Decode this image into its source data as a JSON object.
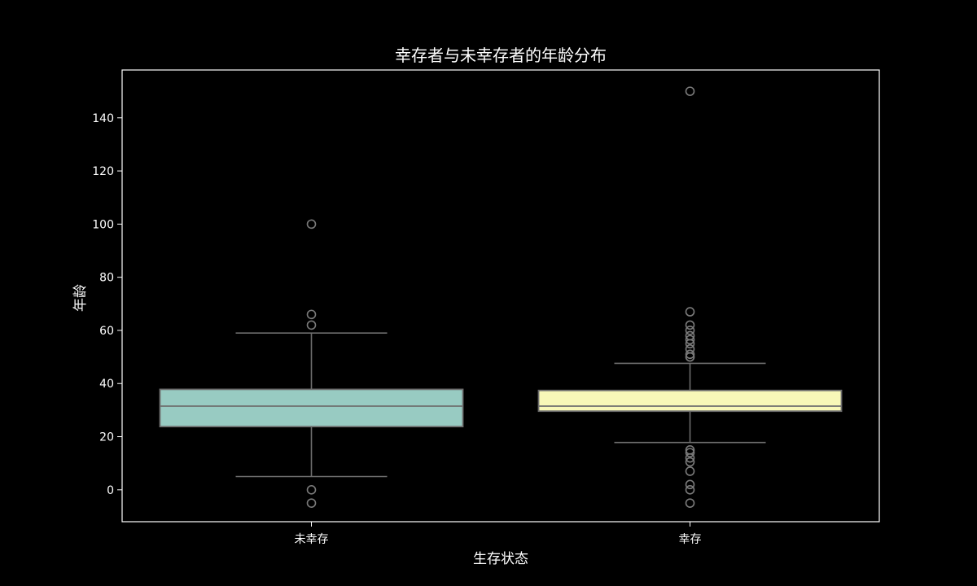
{
  "chart_data": {
    "type": "boxplot",
    "title": "幸存者与未幸存者的年龄分布",
    "xlabel": "生存状态",
    "ylabel": "年龄",
    "ylim": [
      -12,
      158
    ],
    "yticks": [
      0,
      20,
      40,
      60,
      80,
      100,
      120,
      140
    ],
    "grid": false,
    "background": "#000000",
    "colors": {
      "axes": "#ffffff",
      "lines": "#6e6e6e",
      "outlier": "#7a7a7a"
    },
    "categories": [
      "未幸存",
      "幸存"
    ],
    "series": [
      {
        "category": "未幸存",
        "color": "#98cbc2",
        "whisker_low": 5,
        "q1": 23.8,
        "median": 31.5,
        "q3": 37.8,
        "whisker_high": 59,
        "outliers": [
          100,
          66,
          62,
          0,
          -5
        ]
      },
      {
        "category": "幸存",
        "color": "#f8f8b8",
        "whisker_low": 17.8,
        "q1": 29.6,
        "median": 31.5,
        "q3": 37.4,
        "whisker_high": 47.6,
        "outliers": [
          150,
          67,
          62,
          60,
          58,
          56.5,
          55,
          53,
          51,
          50,
          15,
          14,
          12,
          10.5,
          7,
          2,
          0,
          -5
        ]
      }
    ]
  }
}
